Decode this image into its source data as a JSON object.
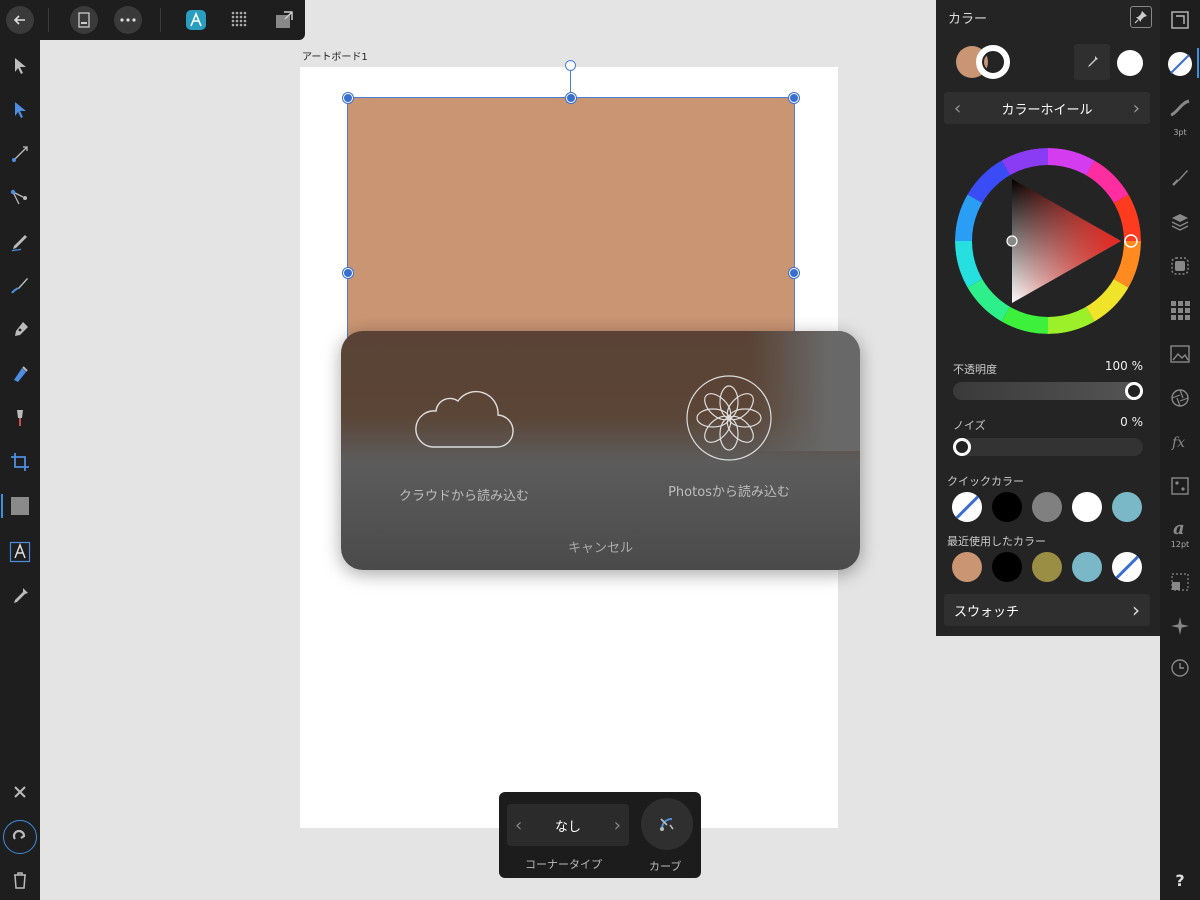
{
  "artboard": {
    "label": "アートボード1"
  },
  "import_popup": {
    "cloud_label": "クラウドから読み込む",
    "photos_label": "Photosから読み込む",
    "cancel_label": "キャンセル"
  },
  "context_toolbar": {
    "corner_value": "なし",
    "corner_label": "コーナータイプ",
    "curve_label": "カーブ"
  },
  "color_panel": {
    "title": "カラー",
    "mode": "カラーホイール",
    "fill_color": "#c99573",
    "opacity_label": "不透明度",
    "opacity_value": "100 %",
    "opacity_fraction": 1.0,
    "noise_label": "ノイズ",
    "noise_value": "0 %",
    "noise_fraction": 0.0,
    "quick_colors_label": "クイックカラー",
    "quick_colors": [
      "none",
      "#000000",
      "#808080",
      "#ffffff",
      "#7ab8c8"
    ],
    "recent_colors_label": "最近使用したカラー",
    "recent_colors": [
      "#c99573",
      "#000000",
      "#9a8e45",
      "#7ab8c8",
      "none"
    ],
    "swatches_label": "スウォッチ"
  },
  "studio_bar": {
    "stroke_width": "3pt",
    "font_size": "12pt",
    "help": "?"
  }
}
